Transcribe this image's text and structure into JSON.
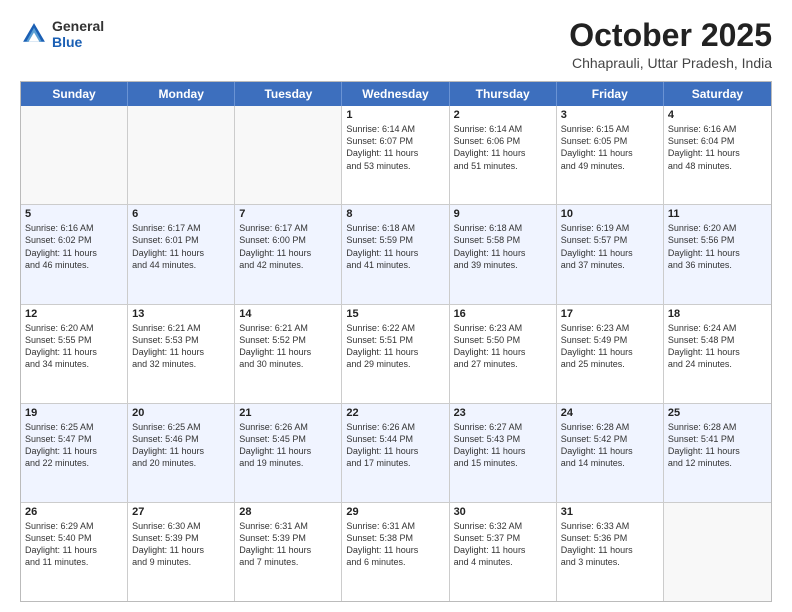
{
  "header": {
    "logo_general": "General",
    "logo_blue": "Blue",
    "title": "October 2025",
    "subtitle": "Chhaprauli, Uttar Pradesh, India"
  },
  "days_of_week": [
    "Sunday",
    "Monday",
    "Tuesday",
    "Wednesday",
    "Thursday",
    "Friday",
    "Saturday"
  ],
  "weeks": [
    [
      {
        "day": "",
        "lines": [],
        "empty": true
      },
      {
        "day": "",
        "lines": [],
        "empty": true
      },
      {
        "day": "",
        "lines": [],
        "empty": true
      },
      {
        "day": "1",
        "lines": [
          "Sunrise: 6:14 AM",
          "Sunset: 6:07 PM",
          "Daylight: 11 hours",
          "and 53 minutes."
        ],
        "empty": false
      },
      {
        "day": "2",
        "lines": [
          "Sunrise: 6:14 AM",
          "Sunset: 6:06 PM",
          "Daylight: 11 hours",
          "and 51 minutes."
        ],
        "empty": false
      },
      {
        "day": "3",
        "lines": [
          "Sunrise: 6:15 AM",
          "Sunset: 6:05 PM",
          "Daylight: 11 hours",
          "and 49 minutes."
        ],
        "empty": false
      },
      {
        "day": "4",
        "lines": [
          "Sunrise: 6:16 AM",
          "Sunset: 6:04 PM",
          "Daylight: 11 hours",
          "and 48 minutes."
        ],
        "empty": false
      }
    ],
    [
      {
        "day": "5",
        "lines": [
          "Sunrise: 6:16 AM",
          "Sunset: 6:02 PM",
          "Daylight: 11 hours",
          "and 46 minutes."
        ],
        "empty": false
      },
      {
        "day": "6",
        "lines": [
          "Sunrise: 6:17 AM",
          "Sunset: 6:01 PM",
          "Daylight: 11 hours",
          "and 44 minutes."
        ],
        "empty": false
      },
      {
        "day": "7",
        "lines": [
          "Sunrise: 6:17 AM",
          "Sunset: 6:00 PM",
          "Daylight: 11 hours",
          "and 42 minutes."
        ],
        "empty": false
      },
      {
        "day": "8",
        "lines": [
          "Sunrise: 6:18 AM",
          "Sunset: 5:59 PM",
          "Daylight: 11 hours",
          "and 41 minutes."
        ],
        "empty": false
      },
      {
        "day": "9",
        "lines": [
          "Sunrise: 6:18 AM",
          "Sunset: 5:58 PM",
          "Daylight: 11 hours",
          "and 39 minutes."
        ],
        "empty": false
      },
      {
        "day": "10",
        "lines": [
          "Sunrise: 6:19 AM",
          "Sunset: 5:57 PM",
          "Daylight: 11 hours",
          "and 37 minutes."
        ],
        "empty": false
      },
      {
        "day": "11",
        "lines": [
          "Sunrise: 6:20 AM",
          "Sunset: 5:56 PM",
          "Daylight: 11 hours",
          "and 36 minutes."
        ],
        "empty": false
      }
    ],
    [
      {
        "day": "12",
        "lines": [
          "Sunrise: 6:20 AM",
          "Sunset: 5:55 PM",
          "Daylight: 11 hours",
          "and 34 minutes."
        ],
        "empty": false
      },
      {
        "day": "13",
        "lines": [
          "Sunrise: 6:21 AM",
          "Sunset: 5:53 PM",
          "Daylight: 11 hours",
          "and 32 minutes."
        ],
        "empty": false
      },
      {
        "day": "14",
        "lines": [
          "Sunrise: 6:21 AM",
          "Sunset: 5:52 PM",
          "Daylight: 11 hours",
          "and 30 minutes."
        ],
        "empty": false
      },
      {
        "day": "15",
        "lines": [
          "Sunrise: 6:22 AM",
          "Sunset: 5:51 PM",
          "Daylight: 11 hours",
          "and 29 minutes."
        ],
        "empty": false
      },
      {
        "day": "16",
        "lines": [
          "Sunrise: 6:23 AM",
          "Sunset: 5:50 PM",
          "Daylight: 11 hours",
          "and 27 minutes."
        ],
        "empty": false
      },
      {
        "day": "17",
        "lines": [
          "Sunrise: 6:23 AM",
          "Sunset: 5:49 PM",
          "Daylight: 11 hours",
          "and 25 minutes."
        ],
        "empty": false
      },
      {
        "day": "18",
        "lines": [
          "Sunrise: 6:24 AM",
          "Sunset: 5:48 PM",
          "Daylight: 11 hours",
          "and 24 minutes."
        ],
        "empty": false
      }
    ],
    [
      {
        "day": "19",
        "lines": [
          "Sunrise: 6:25 AM",
          "Sunset: 5:47 PM",
          "Daylight: 11 hours",
          "and 22 minutes."
        ],
        "empty": false
      },
      {
        "day": "20",
        "lines": [
          "Sunrise: 6:25 AM",
          "Sunset: 5:46 PM",
          "Daylight: 11 hours",
          "and 20 minutes."
        ],
        "empty": false
      },
      {
        "day": "21",
        "lines": [
          "Sunrise: 6:26 AM",
          "Sunset: 5:45 PM",
          "Daylight: 11 hours",
          "and 19 minutes."
        ],
        "empty": false
      },
      {
        "day": "22",
        "lines": [
          "Sunrise: 6:26 AM",
          "Sunset: 5:44 PM",
          "Daylight: 11 hours",
          "and 17 minutes."
        ],
        "empty": false
      },
      {
        "day": "23",
        "lines": [
          "Sunrise: 6:27 AM",
          "Sunset: 5:43 PM",
          "Daylight: 11 hours",
          "and 15 minutes."
        ],
        "empty": false
      },
      {
        "day": "24",
        "lines": [
          "Sunrise: 6:28 AM",
          "Sunset: 5:42 PM",
          "Daylight: 11 hours",
          "and 14 minutes."
        ],
        "empty": false
      },
      {
        "day": "25",
        "lines": [
          "Sunrise: 6:28 AM",
          "Sunset: 5:41 PM",
          "Daylight: 11 hours",
          "and 12 minutes."
        ],
        "empty": false
      }
    ],
    [
      {
        "day": "26",
        "lines": [
          "Sunrise: 6:29 AM",
          "Sunset: 5:40 PM",
          "Daylight: 11 hours",
          "and 11 minutes."
        ],
        "empty": false
      },
      {
        "day": "27",
        "lines": [
          "Sunrise: 6:30 AM",
          "Sunset: 5:39 PM",
          "Daylight: 11 hours",
          "and 9 minutes."
        ],
        "empty": false
      },
      {
        "day": "28",
        "lines": [
          "Sunrise: 6:31 AM",
          "Sunset: 5:39 PM",
          "Daylight: 11 hours",
          "and 7 minutes."
        ],
        "empty": false
      },
      {
        "day": "29",
        "lines": [
          "Sunrise: 6:31 AM",
          "Sunset: 5:38 PM",
          "Daylight: 11 hours",
          "and 6 minutes."
        ],
        "empty": false
      },
      {
        "day": "30",
        "lines": [
          "Sunrise: 6:32 AM",
          "Sunset: 5:37 PM",
          "Daylight: 11 hours",
          "and 4 minutes."
        ],
        "empty": false
      },
      {
        "day": "31",
        "lines": [
          "Sunrise: 6:33 AM",
          "Sunset: 5:36 PM",
          "Daylight: 11 hours",
          "and 3 minutes."
        ],
        "empty": false
      },
      {
        "day": "",
        "lines": [],
        "empty": true
      }
    ]
  ]
}
